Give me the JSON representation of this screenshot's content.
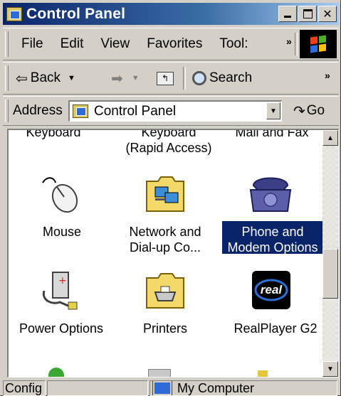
{
  "window": {
    "title": "Control Panel"
  },
  "menu": {
    "items": [
      "File",
      "Edit",
      "View",
      "Favorites",
      "Tool:"
    ],
    "overflow": "»"
  },
  "toolbar": {
    "back": "Back",
    "search": "Search",
    "overflow": "»"
  },
  "address": {
    "label": "Address",
    "value": "Control Panel",
    "go": "Go"
  },
  "items": {
    "keyboard": "Keyboard",
    "keyboard_rapid_1": "Keyboard",
    "keyboard_rapid_2": "(Rapid Access)",
    "mail_fax": "Mail and Fax",
    "mouse": "Mouse",
    "network_1": "Network and",
    "network_2": "Dial-up Co...",
    "phone_1": "Phone and",
    "phone_2": "Modem Options",
    "power": "Power Options",
    "printers": "Printers",
    "realplayer": "RealPlayer G2",
    "realplayer_logo": "real"
  },
  "statusbar": {
    "left": "Config",
    "zone": "My Computer"
  },
  "colors": {
    "title_active": "#0a246a",
    "selection": "#0a246a"
  }
}
